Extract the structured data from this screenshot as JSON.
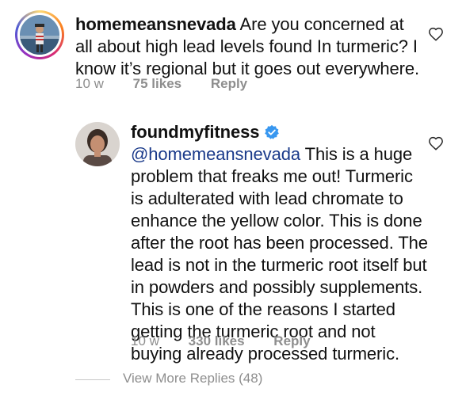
{
  "comment": {
    "username": "homemeansnevada",
    "text": "Are you concerned at all about high lead levels found In turmeric? I know it’s regional but it goes out everywhere.",
    "time": "10 w",
    "likes": "75 likes",
    "reply_label": "Reply",
    "avatar_icon": "user-photo-icon",
    "like_icon": "heart-outline-icon"
  },
  "reply": {
    "username": "foundmyfitness",
    "mention": "@homemeansnevada",
    "text": "This is a huge problem that freaks me out! Turmeric is adulterated with lead chromate to enhance the yellow color. This is done after the root has been processed. The lead is not in the turmeric root itself but in powders and possibly supplements. This is one of the reasons I started getting the turmeric root and not buying already processed turmeric.",
    "time": "10 w",
    "likes": "330 likes",
    "reply_label": "Reply",
    "verified_icon": "verified-badge-icon",
    "avatar_icon": "user-photo-icon",
    "like_icon": "heart-outline-icon"
  },
  "view_more": {
    "label": "View More Replies (48)"
  },
  "colors": {
    "mention": "#1a3a8a",
    "muted": "#8e8e8e",
    "verified": "#3897f0"
  }
}
